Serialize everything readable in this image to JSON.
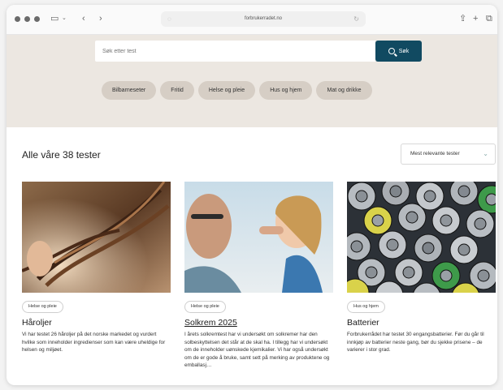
{
  "browser": {
    "url": "forbrukerradet.no"
  },
  "search": {
    "placeholder": "Søk etter test",
    "button_label": "Søk"
  },
  "categories": [
    "Bilbarneseter",
    "Fritid",
    "Helse og pleie",
    "Hus og hjem",
    "Mat og drikke"
  ],
  "results": {
    "heading": "Alle våre 38 tester",
    "sort_label": "Mest relevante tester"
  },
  "cards": [
    {
      "tag": "Helse og pleie",
      "title": "Håroljer",
      "text": "Vi har testet 26 håroljer på det norske markedet og vurdert hvilke som inneholder ingredienser som kan være uheldige for helsen og miljøet."
    },
    {
      "tag": "Helse og pleie",
      "title": "Solkrem 2025",
      "text": "I årets solkremtest har vi undersøkt om solkremer har den solbeskyttelsen det står at de skal ha. I tillegg har vi undersøkt om de inneholder uønskede kjemikalier. Vi har også undersøkt om de er gode å bruke, samt sett på merking av produktene og emballasj…"
    },
    {
      "tag": "Hus og hjem",
      "title": "Batterier",
      "text": "Forbrukerrådet har testet 30 engangsbatterier. Før du går til innkjøp av batterier neste gang, bør du sjekke prisene – de varierer i stor grad."
    }
  ],
  "colors": {
    "accent": "#114a61",
    "hero_bg": "#ece7e1",
    "chip_bg": "#d6cec5"
  }
}
